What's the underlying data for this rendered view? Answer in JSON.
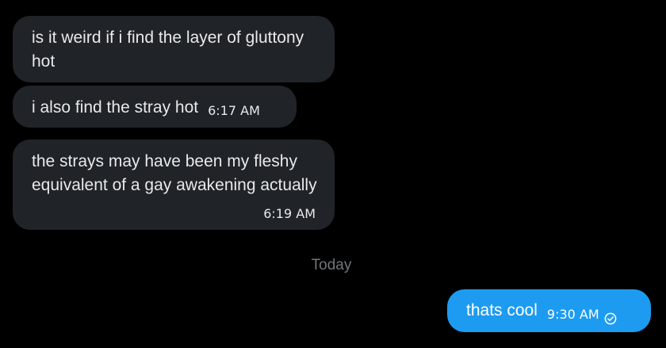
{
  "messages": [
    {
      "id": "msg1",
      "direction": "received",
      "text": "is it weird if i find the layer of gluttony hot",
      "time": ""
    },
    {
      "id": "msg2",
      "direction": "received",
      "text": "i also find the stray hot",
      "time": "6:17 AM"
    },
    {
      "id": "msg3",
      "direction": "received",
      "text": "the strays may have been my fleshy equivalent of a gay awakening actually",
      "time": "6:19 AM"
    },
    {
      "id": "msg4",
      "direction": "sent",
      "text": "thats cool",
      "time": "9:30 AM",
      "status_icon": "read-check-icon"
    }
  ],
  "divider": {
    "label": "Today"
  },
  "colors": {
    "background": "#000000",
    "received_bubble": "#202327",
    "sent_bubble": "#1d9bf0",
    "text": "#e7e9ea",
    "muted": "#71767b"
  }
}
